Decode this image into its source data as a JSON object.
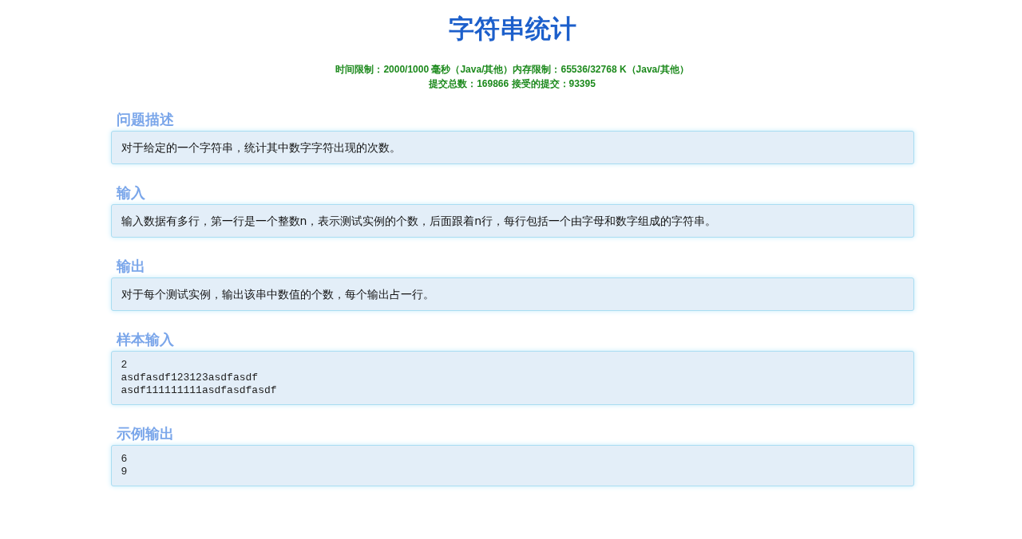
{
  "title": "字符串统计",
  "limits": [
    "时间限制：2000/1000 毫秒（Java/其他）内存限制：65536/32768 K（Java/其他）",
    "提交总数：169866 接受的提交：93395"
  ],
  "sections": [
    {
      "heading": "问题描述",
      "kind": "text",
      "body": [
        "对于给定的一个字符串，统计其中数字字符出现的次数。"
      ]
    },
    {
      "heading": "输入",
      "kind": "text",
      "body": [
        "输入数据有多行，第一行是一个整数n，表示测试实例的个数，后面跟着n行，每行包括一个由字母和数字组成的字符串。"
      ]
    },
    {
      "heading": "输出",
      "kind": "text",
      "body": [
        "对于每个测试实例，输出该串中数值的个数，每个输出占一行。"
      ]
    },
    {
      "heading": "样本输入",
      "kind": "code",
      "body": [
        "2",
        "asdfasdf123123asdfasdf",
        "asdf111111111asdfasdfasdf"
      ]
    },
    {
      "heading": "示例输出",
      "kind": "code",
      "body": [
        "6",
        "9"
      ]
    }
  ]
}
